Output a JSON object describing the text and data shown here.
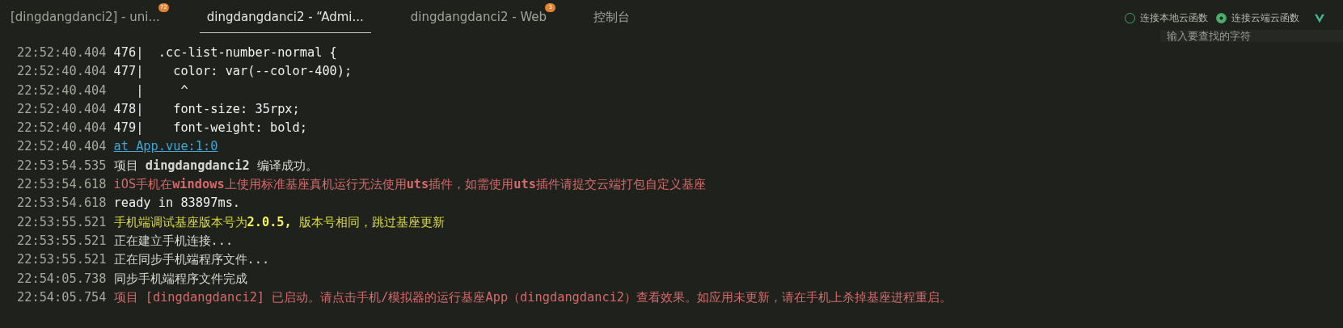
{
  "tabs": [
    {
      "label": "[dingdangdanci2] - uni...",
      "badge": "72",
      "selected": false
    },
    {
      "label": "dingdangdanci2 - “Admi...",
      "selected": true
    },
    {
      "label": "dingdangdanci2 - Web",
      "badge": "3",
      "selected": false
    },
    {
      "label": "控制台",
      "selected": false
    }
  ],
  "cloud_options": [
    {
      "label": "连接本地云函数",
      "selected": false
    },
    {
      "label": "连接云端云函数",
      "selected": true
    }
  ],
  "search": {
    "placeholder": "输入要查找的字符"
  },
  "log": [
    {
      "time": "22:52:40.404",
      "gutter": "476|",
      "text": "  .cc-list-number-normal {",
      "kind": "code"
    },
    {
      "time": "22:52:40.404",
      "gutter": "477|",
      "text": "    color: var(--color-400);",
      "kind": "code"
    },
    {
      "time": "22:52:40.404",
      "gutter": "   |",
      "text": "     ^",
      "kind": "code"
    },
    {
      "time": "22:52:40.404",
      "gutter": "478|",
      "text": "    font-size: 35rpx;",
      "kind": "code"
    },
    {
      "time": "22:52:40.404",
      "gutter": "479|",
      "text": "    font-weight: bold;",
      "kind": "code"
    },
    {
      "time": "22:52:40.404",
      "text": "at App.vue:1:0",
      "kind": "link"
    },
    {
      "time": "22:53:54.535",
      "text": "项目 **dingdangdanci2** 编译成功。",
      "kind": "info"
    },
    {
      "time": "22:53:54.618",
      "text": "iOS手机在**windows**上使用标准基座真机运行无法使用**uts**插件，如需使用**uts**插件请提交云端打包自定义基座",
      "kind": "error"
    },
    {
      "time": "22:53:54.618",
      "text": "ready in 83897ms.",
      "kind": "code"
    },
    {
      "time": "22:53:55.521",
      "text": "手机端调试基座版本号为**2.0.5,** 版本号相同，跳过基座更新",
      "kind": "warn"
    },
    {
      "time": "22:53:55.521",
      "text": "正在建立手机连接...",
      "kind": "info"
    },
    {
      "time": "22:53:55.521",
      "text": "正在同步手机端程序文件...",
      "kind": "info"
    },
    {
      "time": "22:54:05.738",
      "text": "同步手机端程序文件完成",
      "kind": "info"
    },
    {
      "time": "22:54:05.754",
      "text": "项目 [dingdangdanci2] 已启动。请点击手机/模拟器的运行基座App（dingdangdanci2）查看效果。如应用未更新，请在手机上杀掉基座进程重启。",
      "kind": "error"
    }
  ]
}
